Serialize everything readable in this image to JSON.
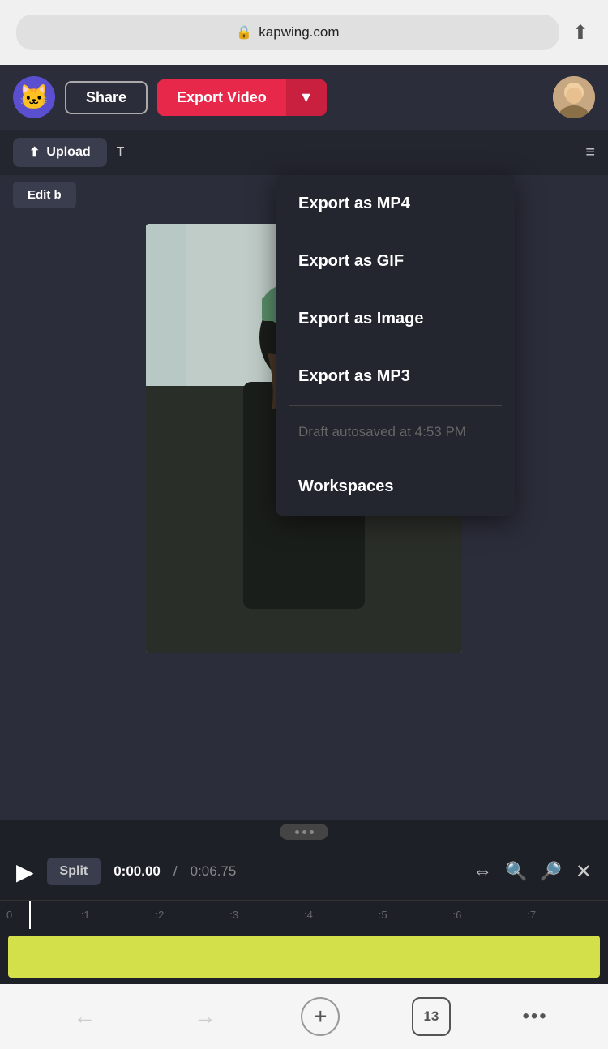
{
  "browser": {
    "url": "kapwing.com",
    "lock_icon": "🔒",
    "share_icon": "⬆"
  },
  "navbar": {
    "logo_emoji": "🐱",
    "share_label": "Share",
    "export_main_label": "Export Video",
    "export_dropdown_icon": "▼",
    "user_icon": "👤"
  },
  "toolbar2": {
    "upload_label": "Upload",
    "upload_icon": "⬆",
    "text_label": "T",
    "menu_icon": "≡"
  },
  "edit_bar": {
    "label": "Edit b"
  },
  "dropdown": {
    "items": [
      {
        "label": "Export as MP4"
      },
      {
        "label": "Export as GIF"
      },
      {
        "label": "Export as Image"
      },
      {
        "label": "Export as MP3"
      }
    ],
    "divider": true,
    "muted_text": "Draft autosaved at 4:53 PM",
    "workspaces_label": "Workspaces"
  },
  "playback": {
    "play_icon": "▶",
    "split_label": "Split",
    "time_current": "0:00.00",
    "time_separator": "/",
    "time_total": "0:06.75",
    "fit_icon": "⇔",
    "zoom_out_icon": "🔍",
    "zoom_in_icon": "🔍",
    "close_icon": "✕"
  },
  "timeline": {
    "marks": [
      "0",
      ":1",
      ":2",
      ":3",
      ":4",
      ":5",
      ":6",
      ":7"
    ]
  },
  "bottom_nav": {
    "back_icon": "←",
    "forward_icon": "→",
    "add_icon": "+",
    "tab_count": "13",
    "more_icon": "•••"
  }
}
